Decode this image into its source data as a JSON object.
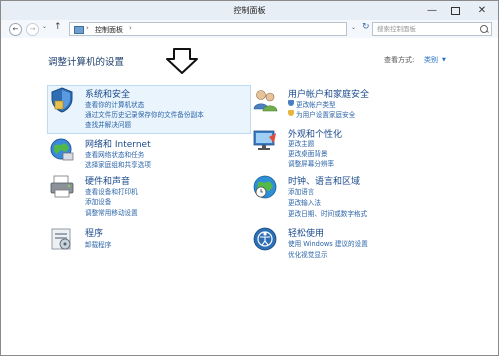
{
  "window": {
    "title": "控制面板",
    "controls": {
      "minimize": "—",
      "close": "✕"
    }
  },
  "address": {
    "crumb": "控制面板",
    "separator": "›",
    "search_placeholder": "搜索控制面板"
  },
  "nav_glyphs": {
    "back": "←",
    "forward": "→",
    "recent": "⌄",
    "up": "↑",
    "drop": "⌄",
    "refresh": "↻"
  },
  "header": {
    "title": "调整计算机的设置",
    "view_label": "查看方式:",
    "view_value": "类别",
    "view_caret": "▼"
  },
  "categories": {
    "system": {
      "title": "系统和安全",
      "links": [
        "查看你的计算机状态",
        "通过文件历史记录保存你的文件备份副本",
        "查找并解决问题"
      ]
    },
    "network": {
      "title": "网络和 Internet",
      "links": [
        "查看网络状态和任务",
        "选择家庭组和共享选项"
      ]
    },
    "hardware": {
      "title": "硬件和声音",
      "links": [
        "查看设备和打印机",
        "添加设备",
        "调整常用移动设置"
      ]
    },
    "programs": {
      "title": "程序",
      "links": [
        "卸载程序"
      ]
    },
    "user": {
      "title": "用户帐户和家庭安全",
      "links": [
        "更改帐户类型",
        "为用户设置家庭安全"
      ]
    },
    "appearance": {
      "title": "外观和个性化",
      "links": [
        "更改主题",
        "更改桌面背景",
        "调整屏幕分辨率"
      ]
    },
    "clock": {
      "title": "时钟、语言和区域",
      "links": [
        "添加语言",
        "更改输入法",
        "更改日期、时间或数字格式"
      ]
    },
    "ease": {
      "title": "轻松使用",
      "links": [
        "使用 Windows 建议的设置",
        "优化视觉显示"
      ]
    }
  },
  "colors": {
    "title_link": "#1a4a8c",
    "link": "#2b64a8",
    "highlight": "#eaf4fc",
    "view_value": "#1e6bc5"
  }
}
